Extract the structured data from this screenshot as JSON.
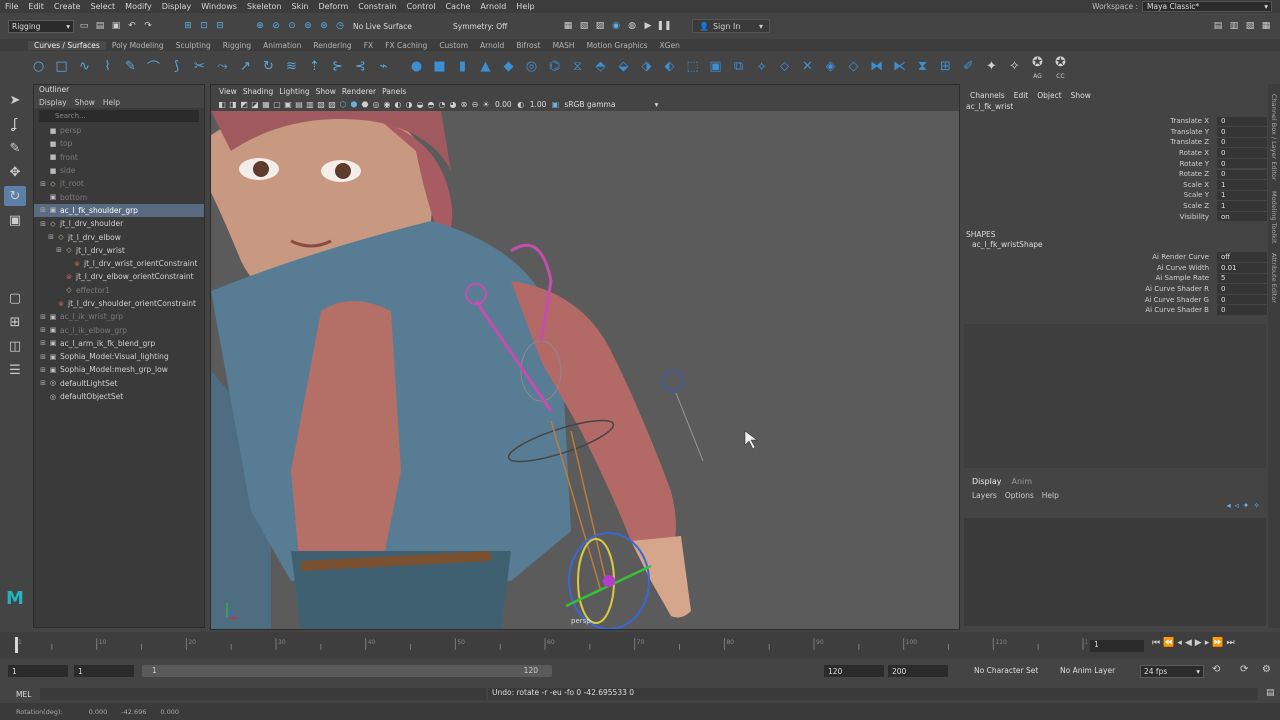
{
  "menubar": [
    "File",
    "Edit",
    "Create",
    "Select",
    "Modify",
    "Display",
    "Windows",
    "Skeleton",
    "Skin",
    "Deform",
    "Constrain",
    "Control",
    "Cache",
    "Arnold",
    "Help"
  ],
  "workspace": {
    "label": "Workspace :",
    "value": "Maya Classic*"
  },
  "statusline": {
    "menuset": "Rigging",
    "live_surface": "No Live Surface",
    "symmetry": "Symmetry: Off",
    "signin": "Sign In"
  },
  "shelf_tabs": [
    "Curves / Surfaces",
    "Poly Modeling",
    "Sculpting",
    "Rigging",
    "Animation",
    "Rendering",
    "FX",
    "FX Caching",
    "Custom",
    "Arnold",
    "Bifrost",
    "MASH",
    "Motion Graphics",
    "XGen"
  ],
  "shelf_labels": {
    "ag": "AG",
    "cc": "CC"
  },
  "outliner": {
    "title": "Outliner",
    "menu": [
      "Display",
      "Show",
      "Help"
    ],
    "search_placeholder": "Search...",
    "items": [
      {
        "label": "persp",
        "dim": true,
        "indent": 0,
        "icon": "camera"
      },
      {
        "label": "top",
        "dim": true,
        "indent": 0,
        "icon": "camera"
      },
      {
        "label": "front",
        "dim": true,
        "indent": 0,
        "icon": "camera"
      },
      {
        "label": "side",
        "dim": true,
        "indent": 0,
        "icon": "camera"
      },
      {
        "label": "jt_root",
        "dim": true,
        "indent": 0,
        "icon": "joint",
        "exp": "+"
      },
      {
        "label": "bottom",
        "dim": true,
        "indent": 0,
        "icon": "group"
      },
      {
        "label": "ac_l_fk_shoulder_grp",
        "dim": false,
        "indent": 0,
        "icon": "group",
        "exp": "+",
        "sel": true
      },
      {
        "label": "jt_l_drv_shoulder",
        "dim": false,
        "indent": 0,
        "icon": "joint",
        "exp": "−"
      },
      {
        "label": "jt_l_drv_elbow",
        "dim": false,
        "indent": 1,
        "icon": "joint",
        "exp": "−"
      },
      {
        "label": "jt_l_drv_wrist",
        "dim": false,
        "indent": 2,
        "icon": "joint",
        "exp": "−"
      },
      {
        "label": "jt_l_drv_wrist_orientConstraint",
        "dim": false,
        "indent": 3,
        "icon": "constraint"
      },
      {
        "label": "jt_l_drv_elbow_orientConstraint",
        "dim": false,
        "indent": 2,
        "icon": "constraint"
      },
      {
        "label": "effector1",
        "dim": true,
        "indent": 2,
        "icon": "joint"
      },
      {
        "label": "jt_l_drv_shoulder_orientConstraint",
        "dim": false,
        "indent": 1,
        "icon": "constraint"
      },
      {
        "label": "ac_l_ik_wrist_grp",
        "dim": true,
        "indent": 0,
        "icon": "group",
        "exp": "+"
      },
      {
        "label": "ac_l_ik_elbow_grp",
        "dim": true,
        "indent": 0,
        "icon": "group",
        "exp": "+"
      },
      {
        "label": "ac_l_arm_ik_fk_blend_grp",
        "dim": false,
        "indent": 0,
        "icon": "group",
        "exp": "+"
      },
      {
        "label": "Sophia_Model:Visual_lighting",
        "dim": false,
        "indent": 0,
        "icon": "group",
        "exp": "+"
      },
      {
        "label": "Sophia_Model:mesh_grp_low",
        "dim": false,
        "indent": 0,
        "icon": "group",
        "exp": "+"
      },
      {
        "label": "defaultLightSet",
        "dim": false,
        "indent": 0,
        "icon": "set",
        "exp": "+"
      },
      {
        "label": "defaultObjectSet",
        "dim": false,
        "indent": 0,
        "icon": "set"
      }
    ]
  },
  "viewport": {
    "menu": [
      "View",
      "Shading",
      "Lighting",
      "Show",
      "Renderer",
      "Panels"
    ],
    "near": "0.00",
    "far": "1.00",
    "colorspace": "sRGB gamma",
    "camera": "persp"
  },
  "channelbox": {
    "menu": [
      "Channels",
      "Edit",
      "Object",
      "Show"
    ],
    "node": "ac_l_fk_wrist",
    "attrs": [
      {
        "name": "Translate X",
        "value": "0"
      },
      {
        "name": "Translate Y",
        "value": "0"
      },
      {
        "name": "Translate Z",
        "value": "0"
      },
      {
        "name": "Rotate X",
        "value": "0"
      },
      {
        "name": "Rotate Y",
        "value": "0"
      },
      {
        "name": "Rotate Z",
        "value": "0"
      },
      {
        "name": "Scale X",
        "value": "1"
      },
      {
        "name": "Scale Y",
        "value": "1"
      },
      {
        "name": "Scale Z",
        "value": "1"
      },
      {
        "name": "Visibility",
        "value": "on"
      }
    ],
    "shapes_header": "SHAPES",
    "shape_node": "ac_l_fk_wristShape",
    "shape_attrs": [
      {
        "name": "Ai Render Curve",
        "value": "off"
      },
      {
        "name": "Ai Curve Width",
        "value": "0.01"
      },
      {
        "name": "Ai Sample Rate",
        "value": "5"
      },
      {
        "name": "Ai Curve Shader R",
        "value": "0"
      },
      {
        "name": "Ai Curve Shader G",
        "value": "0"
      },
      {
        "name": "Ai Curve Shader B",
        "value": "0"
      }
    ]
  },
  "layers": {
    "tabs": [
      "Display",
      "Anim"
    ],
    "menu": [
      "Layers",
      "Options",
      "Help"
    ]
  },
  "sidebar_right": [
    "Channel Box / Layer Editor",
    "Modeling Toolkit",
    "Attribute Editor"
  ],
  "timeslider": {
    "ticks": [
      1,
      5,
      10,
      15,
      20,
      25,
      30,
      35,
      40,
      45,
      50,
      55,
      60,
      65,
      70,
      75,
      80,
      85,
      90,
      95,
      100,
      105,
      110,
      115,
      120
    ],
    "labels": [
      "1",
      "10",
      "20",
      "30",
      "40",
      "50",
      "60",
      "70",
      "80",
      "90",
      "100",
      "110",
      "120"
    ],
    "current_frame": "1"
  },
  "range": {
    "start": "1",
    "anim_start": "1",
    "slider_left": "1",
    "slider_right": "120",
    "anim_end": "120",
    "end": "200",
    "character_set": "No Character Set",
    "anim_layer": "No Anim Layer",
    "fps": "24 fps"
  },
  "cmdline": {
    "lang": "MEL",
    "result": "Undo: rotate -r -eu -fo 0 -42.695533 0"
  },
  "helpline": {
    "label": "Rotation(deg):",
    "values": [
      "0.000",
      "-42.696",
      "0.000"
    ]
  }
}
